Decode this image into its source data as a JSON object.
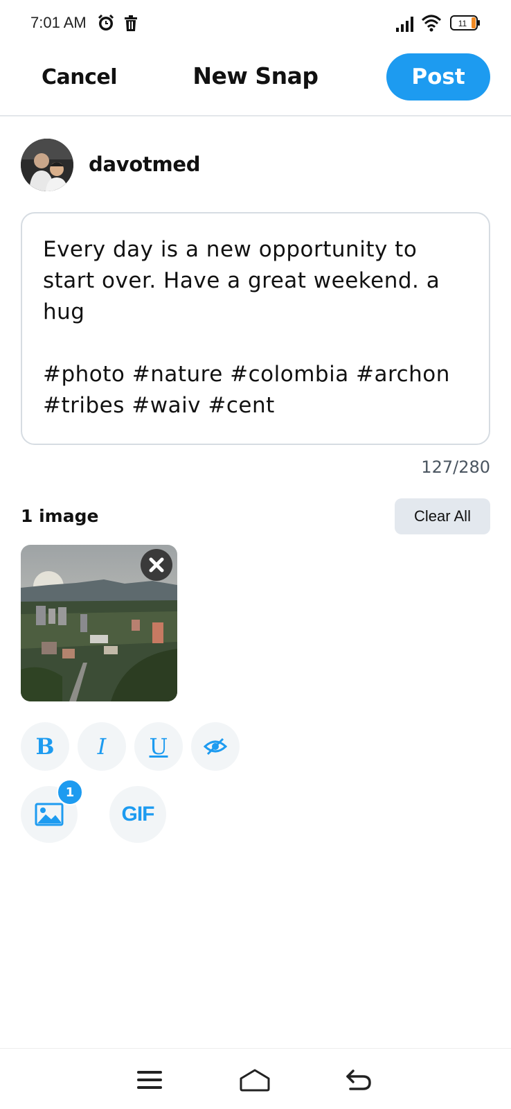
{
  "status_bar": {
    "time": "7:01 AM",
    "battery": "11",
    "icons": [
      "alarm-icon",
      "trash-icon",
      "signal-icon",
      "wifi-icon",
      "battery-icon"
    ]
  },
  "header": {
    "cancel_label": "Cancel",
    "title": "New Snap",
    "post_label": "Post"
  },
  "user": {
    "username": "davotmed"
  },
  "compose": {
    "text": "Every day is a new opportunity to start over. Have a great weekend. a hug\n\n#photo #nature #colombia #archon #tribes #waiv #cent",
    "char_count": "127/280"
  },
  "images": {
    "count_label": "1 image",
    "clear_label": "Clear All"
  },
  "toolbar": {
    "bold_label": "B",
    "italic_label": "I",
    "underline_label": "U",
    "image_badge": "1",
    "gif_label": "GIF"
  },
  "colors": {
    "accent": "#1d9bf0",
    "button_bg": "#f2f5f7",
    "clear_bg": "#e3e8ee"
  }
}
